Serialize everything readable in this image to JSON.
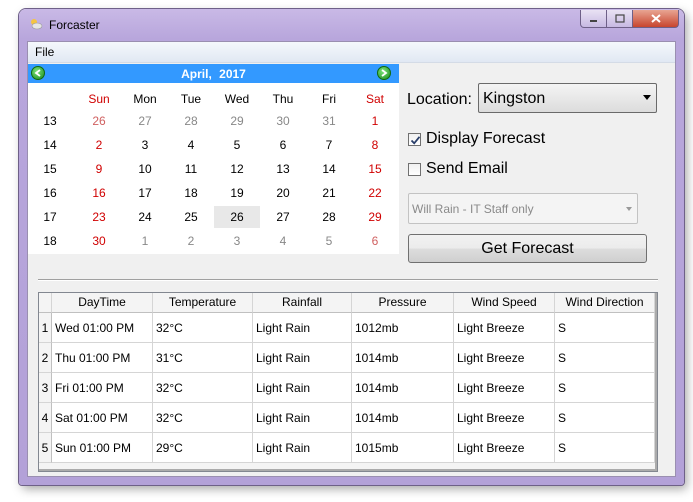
{
  "window": {
    "title": "Forcaster"
  },
  "menu": {
    "file": "File"
  },
  "calendar": {
    "month": "April,",
    "year": "2017",
    "days_of_week": [
      "Sun",
      "Mon",
      "Tue",
      "Wed",
      "Thu",
      "Fri",
      "Sat"
    ],
    "weeks": [
      {
        "num": "13",
        "days": [
          "26",
          "27",
          "28",
          "29",
          "30",
          "31",
          "1"
        ]
      },
      {
        "num": "14",
        "days": [
          "2",
          "3",
          "4",
          "5",
          "6",
          "7",
          "8"
        ]
      },
      {
        "num": "15",
        "days": [
          "9",
          "10",
          "11",
          "12",
          "13",
          "14",
          "15"
        ]
      },
      {
        "num": "16",
        "days": [
          "16",
          "17",
          "18",
          "19",
          "20",
          "21",
          "22"
        ]
      },
      {
        "num": "17",
        "days": [
          "23",
          "24",
          "25",
          "26",
          "27",
          "28",
          "29"
        ]
      },
      {
        "num": "18",
        "days": [
          "30",
          "1",
          "2",
          "3",
          "4",
          "5",
          "6"
        ]
      }
    ],
    "today": "26",
    "weekend_color": "#d00000",
    "header_color": "#3399ff"
  },
  "location": {
    "label": "Location:",
    "value": "Kingston"
  },
  "display_forecast": {
    "label": "Display Forecast",
    "checked": true
  },
  "send_email": {
    "label": "Send Email",
    "checked": false
  },
  "email_recipient": {
    "value": "Will Rain - IT Staff only"
  },
  "get_forecast_button": "Get Forecast",
  "grid": {
    "columns": [
      "DayTime",
      "Temperature",
      "Rainfall",
      "Pressure",
      "Wind Speed",
      "Wind Direction"
    ],
    "rows": [
      {
        "num": "1",
        "cells": [
          "Wed 01:00 PM",
          "32°C",
          "Light Rain",
          "1012mb",
          "Light Breeze",
          "S"
        ]
      },
      {
        "num": "2",
        "cells": [
          "Thu 01:00 PM",
          "31°C",
          "Light Rain",
          "1014mb",
          "Light Breeze",
          "S"
        ]
      },
      {
        "num": "3",
        "cells": [
          "Fri 01:00 PM",
          "32°C",
          "Light Rain",
          "1014mb",
          "Light Breeze",
          "S"
        ]
      },
      {
        "num": "4",
        "cells": [
          "Sat 01:00 PM",
          "32°C",
          "Light Rain",
          "1014mb",
          "Light Breeze",
          "S"
        ]
      },
      {
        "num": "5",
        "cells": [
          "Sun 01:00 PM",
          "29°C",
          "Light Rain",
          "1015mb",
          "Light Breeze",
          "S"
        ]
      }
    ]
  }
}
